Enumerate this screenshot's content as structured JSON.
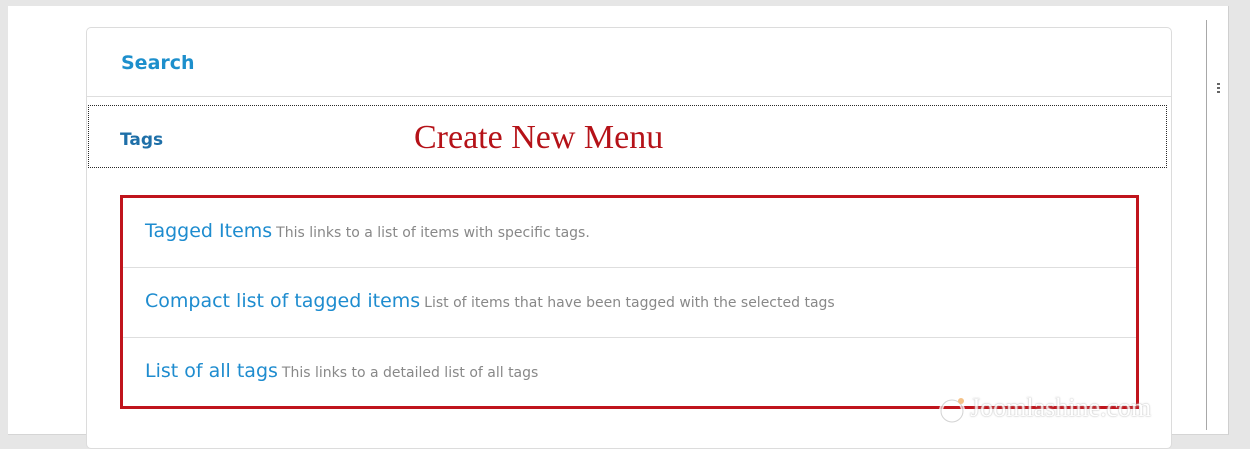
{
  "sections": {
    "search": {
      "label": "Search"
    },
    "tags": {
      "label": "Tags"
    }
  },
  "annotation": {
    "text": "Create New Menu",
    "color": "#b51218"
  },
  "menu_items": [
    {
      "title": "Tagged Items",
      "description": "This links to a list of items with specific tags."
    },
    {
      "title": "Compact list of tagged items",
      "description": "List of items that have been tagged with the selected tags"
    },
    {
      "title": "List of all tags",
      "description": "This links to a detailed list of all tags"
    }
  ],
  "watermark": {
    "text": "Joomlashine.com",
    "icon": "joomlashine-logo-icon"
  },
  "colors": {
    "link_blue": "#1e8ccf",
    "highlight_border": "#c0141c",
    "description_gray": "#888888"
  }
}
